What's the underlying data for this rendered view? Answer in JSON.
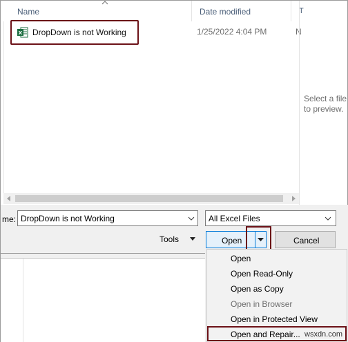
{
  "columns": {
    "name": "Name",
    "date_modified": "Date modified",
    "overflow": "T"
  },
  "file": {
    "name": "DropDown is not Working",
    "date": "1/25/2022 4:04 PM",
    "type_partial": "N",
    "icon": "excel-file-icon"
  },
  "preview": {
    "text": "Select a file to preview."
  },
  "file_name_field": {
    "label": "me:",
    "value": "DropDown is not Working"
  },
  "filter": {
    "value": "All Excel Files"
  },
  "buttons": {
    "tools": "Tools",
    "open": "Open",
    "cancel": "Cancel"
  },
  "open_menu": {
    "items": [
      {
        "label": "Open",
        "enabled": true
      },
      {
        "label": "Open Read-Only",
        "enabled": true
      },
      {
        "label": "Open as Copy",
        "enabled": true
      },
      {
        "label": "Open in Browser",
        "enabled": false
      },
      {
        "label": "Open in Protected View",
        "enabled": true
      },
      {
        "label": "Open and Repair...",
        "enabled": true
      }
    ],
    "highlighted_item": "Open and Repair..."
  },
  "watermark": "wsxdn.com",
  "colors": {
    "highlight_border": "#6b1016",
    "primary_button": "#0078d7",
    "excel_green": "#1d6f42"
  }
}
